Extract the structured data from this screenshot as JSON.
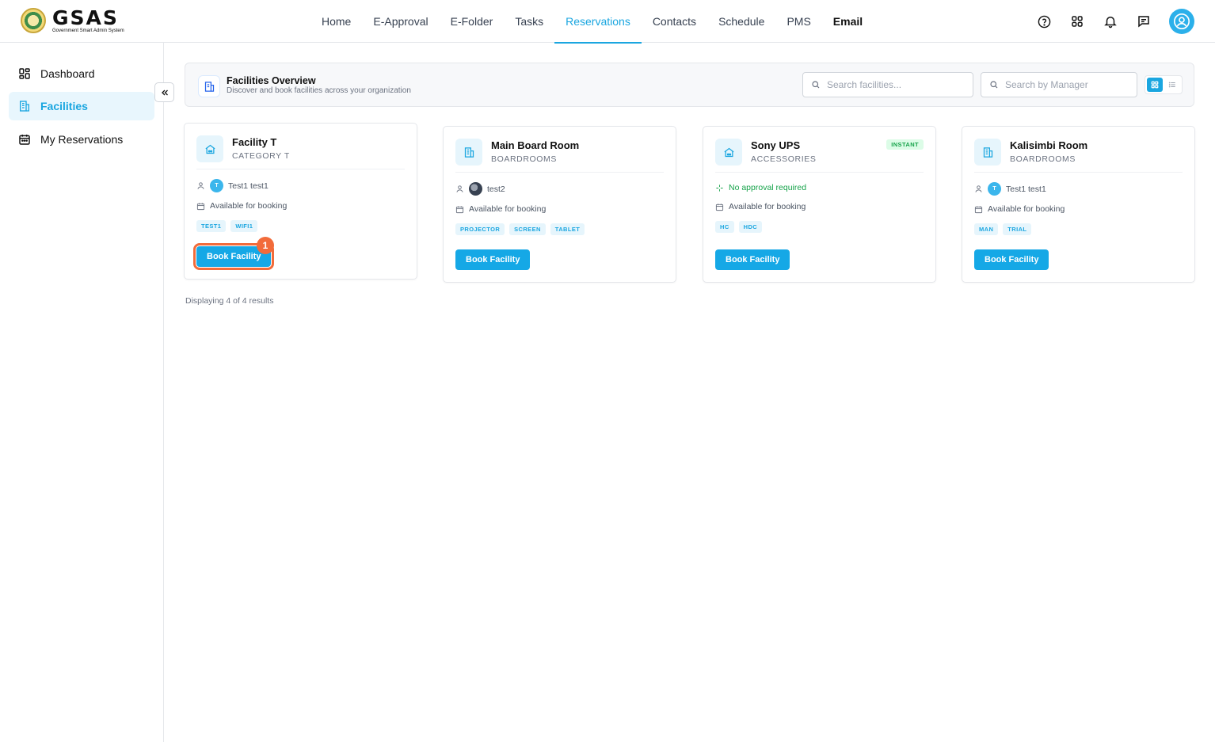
{
  "app": {
    "logo_word": "GSAS",
    "logo_sub": "Government Smart Admin System"
  },
  "nav": [
    {
      "label": "Home"
    },
    {
      "label": "E-Approval"
    },
    {
      "label": "E-Folder"
    },
    {
      "label": "Tasks"
    },
    {
      "label": "Reservations",
      "active": true
    },
    {
      "label": "Contacts"
    },
    {
      "label": "Schedule"
    },
    {
      "label": "PMS"
    },
    {
      "label": "Email"
    }
  ],
  "top_icons": [
    "help-icon",
    "apps-grid-icon",
    "bell-icon",
    "chat-icon",
    "user-avatar-icon"
  ],
  "sidebar": {
    "items": [
      {
        "label": "Dashboard",
        "icon": "dashboard-icon"
      },
      {
        "label": "Facilities",
        "icon": "building-icon",
        "active": true
      },
      {
        "label": "My Reservations",
        "icon": "calendar-icon"
      }
    ]
  },
  "overview": {
    "title": "Facilities Overview",
    "subtitle": "Discover and book facilities across your organization",
    "search_facilities_placeholder": "Search facilities...",
    "search_manager_placeholder": "Search by Manager",
    "view_mode": "grid"
  },
  "cards": [
    {
      "name": "Facility T",
      "category": "CATEGORY T",
      "icon": "home-icon",
      "manager": "Test1 test1",
      "manager_initial": "T",
      "availability": "Available for booking",
      "tags": [
        "TEST1",
        "WIFI1"
      ],
      "button": "Book Facility"
    },
    {
      "name": "Main Board Room",
      "category": "BOARDROOMS",
      "icon": "building-icon",
      "manager": "test2",
      "availability": "Available for booking",
      "tags": [
        "PROJECTOR",
        "SCREEN",
        "TABLET"
      ],
      "button": "Book Facility"
    },
    {
      "name": "Sony UPS",
      "category": "ACCESSORIES",
      "icon": "home-icon",
      "badge": "INSTANT",
      "approval": "No approval required",
      "availability": "Available for booking",
      "tags": [
        "HC",
        "HDC"
      ],
      "button": "Book Facility"
    },
    {
      "name": "Kalisimbi Room",
      "category": "BOARDROOMS",
      "icon": "building-icon",
      "manager": "Test1 test1",
      "manager_initial": "T",
      "availability": "Available for booking",
      "tags": [
        "MAN",
        "TRIAL"
      ],
      "button": "Book Facility"
    }
  ],
  "annotation_badge": "1",
  "results_text": "Displaying 4 of 4 results",
  "colors": {
    "accent": "#1aa6e0",
    "button": "#15a8e6",
    "highlight": "#f26b3a",
    "success": "#16a34a"
  }
}
